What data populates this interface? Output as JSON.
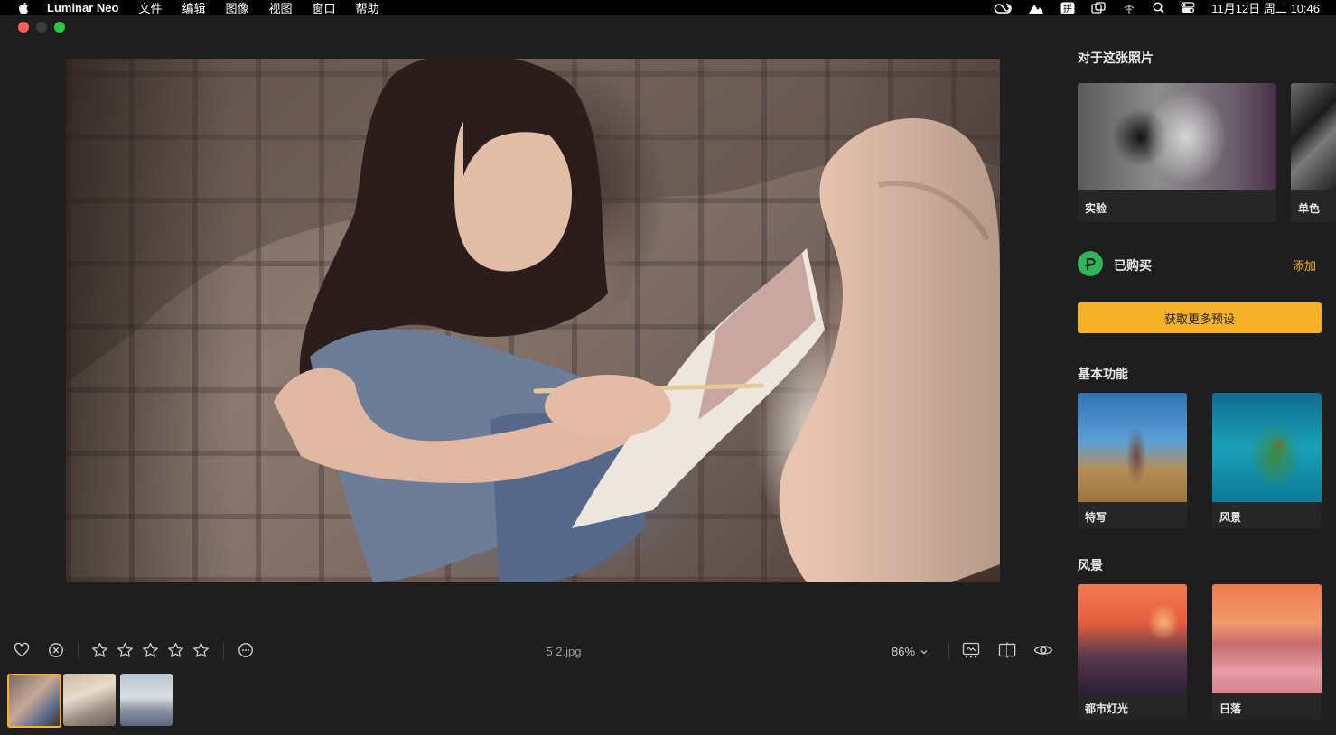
{
  "menubar": {
    "app_name": "Luminar Neo",
    "items": [
      "文件",
      "编辑",
      "图像",
      "视图",
      "窗口",
      "帮助"
    ],
    "clock": "11月12日 周二  10:46",
    "icons": [
      "apple-icon",
      "creative-cloud-icon",
      "cloud-icon",
      "input-method-icon",
      "screen-mirror-icon",
      "wifi-icon",
      "search-icon",
      "control-center-icon"
    ]
  },
  "colors": {
    "accent": "#f5b12a",
    "link": "#f5b400",
    "purchased": "#2fb45a",
    "background": "#1e1e1e"
  },
  "toolbar": {
    "filename": "5 2.jpg",
    "zoom": "86%",
    "rating_stars": 0,
    "icons": [
      "heart-icon",
      "reject-icon",
      "star-icon",
      "more-icon",
      "info-panel-icon",
      "compare-icon",
      "eye-icon"
    ]
  },
  "filmstrip": {
    "count": 3,
    "selected_index": 0
  },
  "panel": {
    "about_title": "对于这张照片",
    "about_cards": [
      {
        "label": "实验"
      },
      {
        "label": "单色"
      }
    ],
    "purchased_label": "已购买",
    "add_label": "添加",
    "more_presets_label": "获取更多预设",
    "basics_title": "基本功能",
    "basics_cards": [
      {
        "label": "特写"
      },
      {
        "label": "风景"
      }
    ],
    "landscape_title": "风景",
    "landscape_cards": [
      {
        "label": "都市灯光"
      },
      {
        "label": "日落"
      }
    ]
  }
}
